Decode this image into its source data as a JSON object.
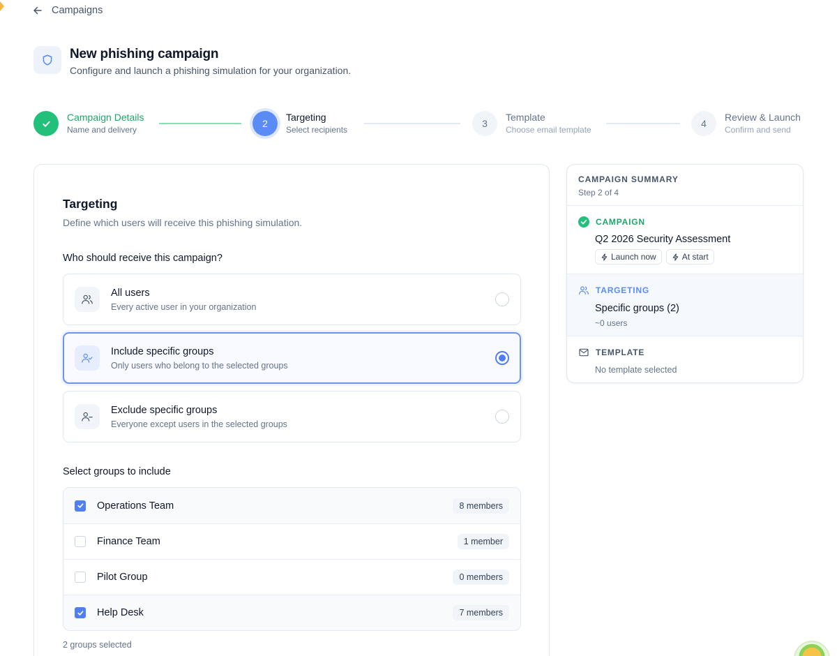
{
  "nav": {
    "back_label": "Campaigns"
  },
  "header": {
    "title": "New phishing campaign",
    "subtitle": "Configure and launch a phishing simulation for your organization."
  },
  "steps": [
    {
      "number": "1",
      "title": "Campaign Details",
      "description": "Name and delivery",
      "state": "done"
    },
    {
      "number": "2",
      "title": "Targeting",
      "description": "Select recipients",
      "state": "active"
    },
    {
      "number": "3",
      "title": "Template",
      "description": "Choose email template",
      "state": "pending"
    },
    {
      "number": "4",
      "title": "Review & Launch",
      "description": "Confirm and send",
      "state": "pending"
    }
  ],
  "targeting": {
    "title": "Targeting",
    "description": "Define which users will receive this phishing simulation.",
    "question": "Who should receive this campaign?",
    "options": [
      {
        "title": "All users",
        "description": "Every active user in your organization",
        "selected": false
      },
      {
        "title": "Include specific groups",
        "description": "Only users who belong to the selected groups",
        "selected": true
      },
      {
        "title": "Exclude specific groups",
        "description": "Everyone except users in the selected groups",
        "selected": false
      }
    ],
    "groups_label": "Select groups to include",
    "groups": [
      {
        "name": "Operations Team",
        "members": "8 members",
        "checked": true
      },
      {
        "name": "Finance Team",
        "members": "1 member",
        "checked": false
      },
      {
        "name": "Pilot Group",
        "members": "0 members",
        "checked": false
      },
      {
        "name": "Help Desk",
        "members": "7 members",
        "checked": true
      }
    ],
    "selected_count": "2 groups selected"
  },
  "summary": {
    "heading": "CAMPAIGN SUMMARY",
    "step": "Step 2 of 4",
    "campaign": {
      "label": "CAMPAIGN",
      "name": "Q2 2026 Security Assessment",
      "chips": [
        "Launch now",
        "At start"
      ]
    },
    "targeting": {
      "label": "TARGETING",
      "value": "Specific groups (2)",
      "sub": "~0 users"
    },
    "template": {
      "label": "TEMPLATE",
      "value": "No template selected"
    }
  },
  "colors": {
    "primary": "#5b8cf5",
    "success": "#22c07a",
    "text": "#0f172a",
    "muted": "#64748b",
    "border": "#e2e8f0"
  }
}
